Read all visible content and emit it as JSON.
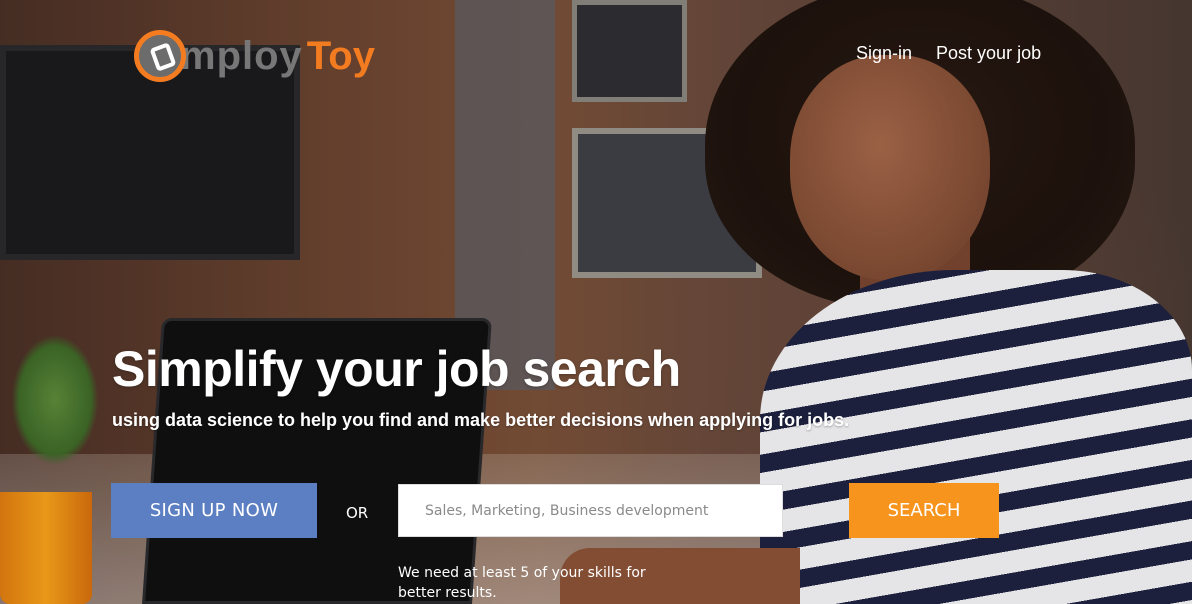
{
  "brand": {
    "name_part1": "mploy",
    "name_part2": "Toy",
    "accent_color": "#f47c20"
  },
  "nav": {
    "signin": "Sign-in",
    "post_job": "Post your job"
  },
  "hero": {
    "headline": "Simplify your job search",
    "subline": "using data science to help you find and make better decisions when applying for jobs."
  },
  "actions": {
    "signup_label": "SIGN UP NOW",
    "or_label": "OR",
    "search_placeholder": "Sales, Marketing, Business development",
    "search_label": "SEARCH",
    "hint": "We need at least 5 of your skills for better results."
  },
  "colors": {
    "signup_button": "#5b7fc2",
    "search_button": "#f7941d"
  }
}
